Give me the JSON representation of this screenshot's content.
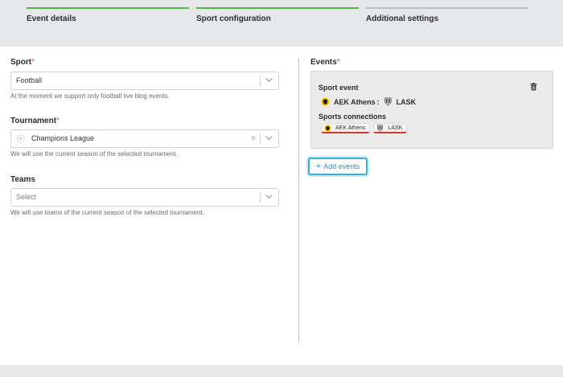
{
  "stepper": {
    "steps": [
      {
        "label": "Event details",
        "color": "#52b847"
      },
      {
        "label": "Sport configuration",
        "color": "#52b847"
      },
      {
        "label": "Additional settings",
        "color": "#bdbdbd"
      }
    ]
  },
  "left": {
    "sport": {
      "label": "Sport",
      "required_mark": "*",
      "value": "Football",
      "hint": "At the moment we support only football live blog events."
    },
    "tournament": {
      "label": "Tournament",
      "required_mark": "*",
      "value": "Champions League",
      "clear": "×",
      "hint": "We will use the current season of the selected tournament."
    },
    "teams": {
      "label": "Teams",
      "placeholder": "Select",
      "hint": "We will use teams of the current season of the selected tournament."
    }
  },
  "right": {
    "events_label": "Events",
    "required_mark": "*",
    "event": {
      "title": "Sport event",
      "home": "AEK Athens",
      "separator": ":",
      "away": "LASK",
      "connections_title": "Sports connections",
      "connections": [
        "AEK Athens",
        "LASK"
      ]
    },
    "add_button": {
      "icon": "+",
      "label": "Add events"
    }
  }
}
